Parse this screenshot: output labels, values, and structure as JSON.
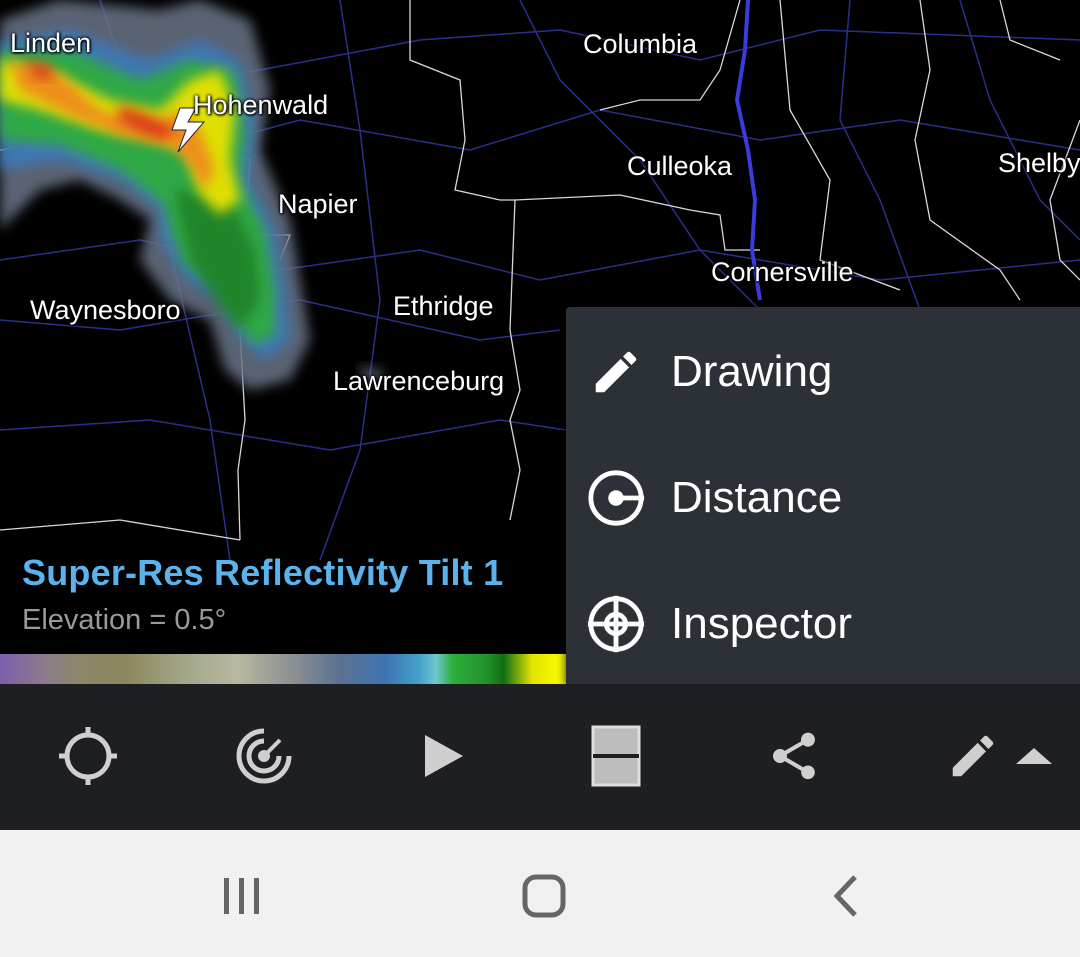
{
  "map": {
    "cities": [
      {
        "name": "Linden"
      },
      {
        "name": "Hohenwald"
      },
      {
        "name": "Napier"
      },
      {
        "name": "Waynesboro"
      },
      {
        "name": "Ethridge"
      },
      {
        "name": "Lawrenceburg"
      },
      {
        "name": "Columbia"
      },
      {
        "name": "Culleoka"
      },
      {
        "name": "Cornersville"
      },
      {
        "name": "Shelby"
      }
    ]
  },
  "product": {
    "title": "Super-Res Reflectivity Tilt 1",
    "elevation": "Elevation = 0.5°"
  },
  "menu": {
    "items": [
      {
        "label": "Drawing",
        "icon": "pencil-icon"
      },
      {
        "label": "Distance",
        "icon": "distance-icon"
      },
      {
        "label": "Inspector",
        "icon": "crosshair-icon"
      }
    ]
  },
  "toolbar": {
    "buttons": [
      {
        "icon": "locate-icon"
      },
      {
        "icon": "radar-icon"
      },
      {
        "icon": "play-icon"
      },
      {
        "icon": "split-layout-icon"
      },
      {
        "icon": "share-icon"
      },
      {
        "icon": "pencil-icon"
      }
    ]
  },
  "navbar": {
    "buttons": [
      {
        "icon": "recent-apps-icon"
      },
      {
        "icon": "home-icon"
      },
      {
        "icon": "back-icon"
      }
    ]
  },
  "colors": {
    "title_blue": "#5ab3ec",
    "menu_bg": "#2c3138",
    "toolbar_bg": "#1d1f23",
    "navbar_bg": "#f1f1f1"
  }
}
